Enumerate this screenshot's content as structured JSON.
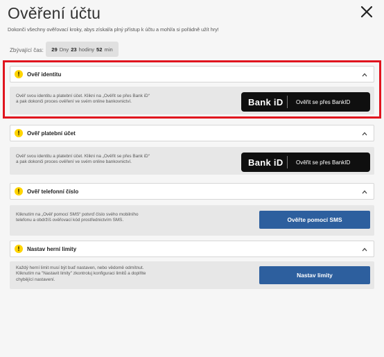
{
  "modal": {
    "title": "Ověření účtu",
    "subtitle": "Dokonči všechny ověřovací kroky, abys získal/a plný přístup k účtu a mohl/a si pořádně užít hry!",
    "time_label": "Zbývající čas:",
    "time": {
      "days": "29",
      "days_unit": "Dny",
      "hours": "23",
      "hours_unit": "hodiny",
      "minutes": "52",
      "minutes_unit": "min"
    }
  },
  "sections": [
    {
      "title": "Ověř identitu",
      "text": "Ověř svou identitu a platební účet. Klikni na „Ověřit se přes Bank iD“\na pak dokonči proces ověření ve svém online bankovnictví.",
      "logo": "Bank iD",
      "button": "Ověřit se přes BankID"
    },
    {
      "title": "Ověř platební účet",
      "text": "Ověř svou identitu a platební účet. Klikni na „Ověřit se přes Bank iD“\na pak dokonči proces ověření ve svém online bankovnictví.",
      "logo": "Bank iD",
      "button": "Ověřit se přes BankID"
    },
    {
      "title": "Ověř telefonní číslo",
      "text": "Kliknutím na „Ověř pomocí SMS“ potvrď číslo svého mobilního\ntelefonu a obdržíš ověřovací kód prostřednictvím SMS.",
      "button": "Ověřte pomocí SMS"
    },
    {
      "title": "Nastav herní limity",
      "text": "Každý herní limit musí být buď nastaven, nebo vědomě odmítnut.\nKliknutím na \"Nastavit limity\" zkontroluj konfiguraci limitů a doplňte\nchybějící nastavení.",
      "button": "Nastav limity"
    }
  ],
  "colors": {
    "highlight": "#e0141e",
    "warning": "#ffd400",
    "primary_button": "#2d5f9e",
    "bankid_button": "#0f0f0f"
  },
  "icons": {
    "close": "close-icon",
    "warning": "warning-icon",
    "collapse": "chevron-up-icon"
  }
}
